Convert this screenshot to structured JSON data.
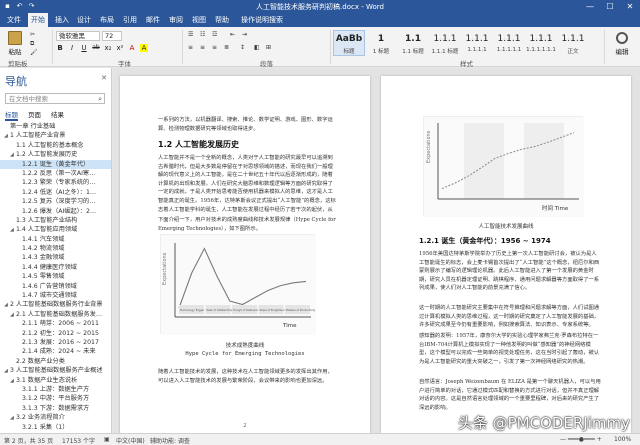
{
  "window": {
    "title": "人工智能技术服务研判初稿.docx - Word",
    "controls": [
      "—",
      "☐",
      "✕"
    ]
  },
  "tabs": [
    "文件",
    "开始",
    "插入",
    "设计",
    "布局",
    "引用",
    "邮件",
    "审阅",
    "视图",
    "帮助",
    "操作说明搜索"
  ],
  "ribbon": {
    "paste_label": "粘贴",
    "clipboard_label": "剪贴板",
    "font_name": "微软雅黑",
    "font_size": "72",
    "font_label": "字体",
    "paragraph_label": "段落",
    "styles_label": "样式",
    "editing_label": "编辑",
    "format_buttons": [
      "B",
      "I",
      "U",
      "ab",
      "x₂",
      "x²",
      "A",
      "A"
    ],
    "styles": [
      {
        "preview": "AaBb",
        "name": "标题"
      },
      {
        "preview": "1",
        "name": "1 标题"
      },
      {
        "preview": "1.1",
        "name": "1.1 标题"
      },
      {
        "preview": "1.1.1",
        "name": "1.1.1 标题"
      },
      {
        "preview": "1.1.1",
        "name": "1.1.1.1"
      },
      {
        "preview": "1.1.1",
        "name": "1.1.1.1.1"
      },
      {
        "preview": "1.1.1",
        "name": "1.1.1.1.1.1"
      },
      {
        "preview": "1.1.1",
        "name": "正文"
      }
    ]
  },
  "nav": {
    "title": "导航",
    "close": "✕",
    "search_placeholder": "在文档中搜索",
    "tabs": [
      "标题",
      "页面",
      "结果"
    ],
    "items": [
      {
        "label": "第一章 行业基础",
        "level": 0,
        "tri": ""
      },
      {
        "label": "1 人工智能产业背景",
        "level": 0,
        "tri": "◢"
      },
      {
        "label": "1.1 人工智能的基本概念",
        "level": 1,
        "tri": ""
      },
      {
        "label": "1.2 人工智能发展历史",
        "level": 1,
        "tri": "◢"
      },
      {
        "label": "1.2.1 诞生（黄金年代）",
        "level": 2,
        "tri": "",
        "selected": true
      },
      {
        "label": "1.2.2 反思（第一次AI寒…",
        "level": 2,
        "tri": ""
      },
      {
        "label": "1.2.3 繁荣（专家系统的…",
        "level": 2,
        "tri": ""
      },
      {
        "label": "1.2.4 低迷（AI之冬）：1…",
        "level": 2,
        "tri": ""
      },
      {
        "label": "1.2.5 复苏（深度学习的…",
        "level": 2,
        "tri": ""
      },
      {
        "label": "1.2.6 爆发（AI崛起）：2…",
        "level": 2,
        "tri": ""
      },
      {
        "label": "1.3 人工智能产业结构",
        "level": 1,
        "tri": ""
      },
      {
        "label": "1.4 人工智能应用领域",
        "level": 1,
        "tri": "◢"
      },
      {
        "label": "1.4.1 汽车领域",
        "level": 2,
        "tri": ""
      },
      {
        "label": "1.4.2 物流领域",
        "level": 2,
        "tri": ""
      },
      {
        "label": "1.4.3 金融领域",
        "level": 2,
        "tri": ""
      },
      {
        "label": "1.4.4 健康医疗领域",
        "level": 2,
        "tri": ""
      },
      {
        "label": "1.4.5 零售领域",
        "level": 2,
        "tri": ""
      },
      {
        "label": "1.4.6 广告营销领域",
        "level": 2,
        "tri": ""
      },
      {
        "label": "1.4.7 城市交通领域",
        "level": 2,
        "tri": ""
      },
      {
        "label": "2 人工智能基础数据服务行业背景",
        "level": 0,
        "tri": "◢"
      },
      {
        "label": "2.1 人工智能基础数据服务发…",
        "level": 1,
        "tri": "◢"
      },
      {
        "label": "2.1.1 萌芽：2006 ~ 2011",
        "level": 2,
        "tri": ""
      },
      {
        "label": "2.1.2 初生：2012 ~ 2015",
        "level": 2,
        "tri": ""
      },
      {
        "label": "2.1.3 发展：2016 ~ 2017",
        "level": 2,
        "tri": ""
      },
      {
        "label": "2.1.4 成熟：2024 ~ 未来",
        "level": 2,
        "tri": ""
      },
      {
        "label": "2.2 数据产业分类",
        "level": 1,
        "tri": ""
      },
      {
        "label": "3 人工智能基础数据服务产业概述",
        "level": 0,
        "tri": "◢"
      },
      {
        "label": "3.1 数据产业生态说析",
        "level": 1,
        "tri": "◢"
      },
      {
        "label": "3.1.1 上游：数据生产方",
        "level": 2,
        "tri": ""
      },
      {
        "label": "3.1.2 中游：平台服务方",
        "level": 2,
        "tri": ""
      },
      {
        "label": "3.1.3 下游：数据需求方",
        "level": 2,
        "tri": ""
      },
      {
        "label": "3.2 业务流程简介",
        "level": 1,
        "tri": "◢"
      },
      {
        "label": "3.2.1 采集（1）",
        "level": 2,
        "tri": ""
      }
    ]
  },
  "left_page": {
    "intro_text": "一系列的方法，以机器翻译、搜索、推论、数学证明、游戏、图形、数字运算、检测物理数据研究等领域也取得进步。",
    "heading": "1.2 人工智能发展历史",
    "para1": "人工智能并不是一个全新的概念，人类对于人工智能的研究最早可以追溯到古希腊时代，但是大多数是停留在于对思想领域的描述，而现在我们一般理解的现代意义上的人工智能，是在二十世纪五十年代以后逐渐形成的，随着计算机的出现和发展，人们在研究大脑思维和数理逻辑等方面的研究取得了一定的成就，于是人类开始思考能否使用机器来模拟人的思维，这才是人工智能真正的诞生。1956年，达特茅斯会议正式提出“人工智能”的概念，这标志着人工智能学科的诞生，人工智能在发展过程中经历了若干次的起伏，从最早对人工智能的热情到后来的挫折，经历了许多困难和曲折之后，本次将从技术的角度，梳理人工智能的发展历史，以及人工智能发展的几个重要阶段，来加深对人工智能的理解。",
    "para2": "下面介绍一下，用户对技术的成熟度曲线和技术发展规律（Hype Cycle for Emerging Technologies），如下图所示。",
    "chart_title": "技术成熟度曲线",
    "chart_caption": "Hype Cycle for Emerging Technologies",
    "para3": "随着人工智能技术的发展，这种技术在人工智能领域更多的发挥出其作用，可以进入人工智能技术的发展与繁荣阶段，会议带来的影响也更加深远。"
  },
  "right_page": {
    "chart_caption": "人工智能技术发展曲线",
    "heading": "1.2.1 诞生（黄金年代）：1956 ~ 1974",
    "para1": "1956年美国达特茅斯学院举办了历史上第一次人工智能研讨会，被认为是人工智能诞生的标志，会上麦卡锡首次提出了“人工智能”这个概念，纽厄尔和西蒙则展示了编写的逻辑理论机器。此后人工智能进入了第一个发展的黄金时期，研究人员在机器定理证明、跳棋程序、通用问题求解器等方面取得了一系列成果，使人们对人工智能的前景充满了信心。",
    "para2": "这一时期的人工智能研究主要集中在符号推理和问题求解等方面，人们试图通过计算机模拟人类的思维过程，这一时期的研究奠定了人工智能发展的基础，许多研究成果至今仍有重要影响，例如搜索算法、知识表示、专家系统等。",
    "para3": "感知器的发明：1957年，康奈尔大学的实验心理学家弗兰克·罗森布拉特在一台IBM-704计算机上模拟实现了一种他发明的叫做“感知器”的神经网络模型，这个模型可以完成一些简单的视觉处理任务，这在当时引起了轰动，被认为是人工智能研究的重大突破之一，引发了第一次神经网络研究的热潮。",
    "para4": "自然语言：Joseph Weizenbaum 在 ELIZA 是第一个聊天机器人，可以与用户进行简单的对话，它通过模式匹配和替换的方式进行对话，但并不真正理解对话的内容。这是自然语言处理领域的一个重要里程碑，对后来的研究产生了深远的影响。"
  },
  "status": {
    "page": "第 2 页，共 35 页",
    "words": "17153 个字",
    "lang": "中文(中国)",
    "a11y": "辅助功能: 调查",
    "zoom": "100%"
  },
  "watermark": "头条 @PMCODERJimmy",
  "chart_data": [
    {
      "type": "line",
      "title": "技术成熟度曲线",
      "xlabel": "Time",
      "ylabel": "Expectations",
      "x": [
        0,
        1,
        2,
        3,
        4,
        5,
        6,
        7,
        8,
        9,
        10
      ],
      "series": [
        {
          "values": [
            0.1,
            0.6,
            0.95,
            0.55,
            0.2,
            0.15,
            0.25,
            0.35,
            0.42,
            0.46,
            0.48
          ]
        }
      ],
      "phases": [
        "Technology Trigger",
        "Peak of Inflated Expectations",
        "Trough of Disillusionment",
        "Slope of Enlightenment",
        "Plateau of Productivity"
      ]
    },
    {
      "type": "line",
      "title": "人工智能技术发展曲线",
      "xlabel": "时间 Time",
      "ylabel": "Expectations",
      "x": [
        0,
        1,
        2,
        3,
        4,
        5,
        6,
        7,
        8,
        9,
        10
      ],
      "series": [
        {
          "values": [
            0.12,
            0.2,
            0.3,
            0.42,
            0.55,
            0.62,
            0.68,
            0.72,
            0.78,
            0.85,
            0.92
          ]
        }
      ]
    }
  ],
  "colors": {
    "word_blue": "#2b579a",
    "chart_line": "#7a7a7a",
    "selection": "#cde3f7"
  }
}
